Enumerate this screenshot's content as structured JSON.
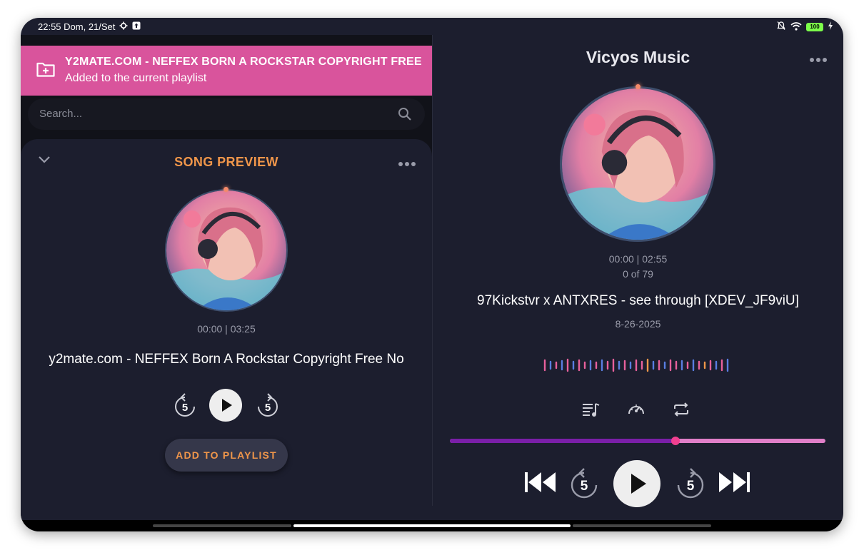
{
  "status_bar": {
    "time": "22:55 Dom, 21/Set",
    "battery": "100"
  },
  "notification": {
    "title": "Y2MATE.COM - NEFFEX  BORN A ROCKSTAR  COPYRIGHT FREE ...",
    "subtitle": "Added to the current playlist"
  },
  "search": {
    "placeholder": "Search..."
  },
  "song_preview": {
    "title": "SONG PREVIEW",
    "time": "00:00 | 03:25",
    "song_name": "y2mate.com - NEFFEX  Born A Rockstar  Copyright Free No",
    "skip_back_seconds": "5",
    "skip_forward_seconds": "5",
    "add_button": "ADD TO PLAYLIST"
  },
  "player": {
    "app_title": "Vicyos Music",
    "time": "00:00 | 02:55",
    "track_count": "0 of 79",
    "song_name": "97Kickstvr x ANTXRES - see through [XDEV_JF9viU]",
    "date": "8-26-2025",
    "progress_fraction": 0.6,
    "skip_back_seconds": "5",
    "skip_forward_seconds": "5"
  },
  "colors": {
    "accent_orange": "#f0964a",
    "notification_pink": "#d9549c",
    "background": "#1c1e2e",
    "progress_fill": "#7a1fa8",
    "progress_track": "#e07fc8"
  }
}
